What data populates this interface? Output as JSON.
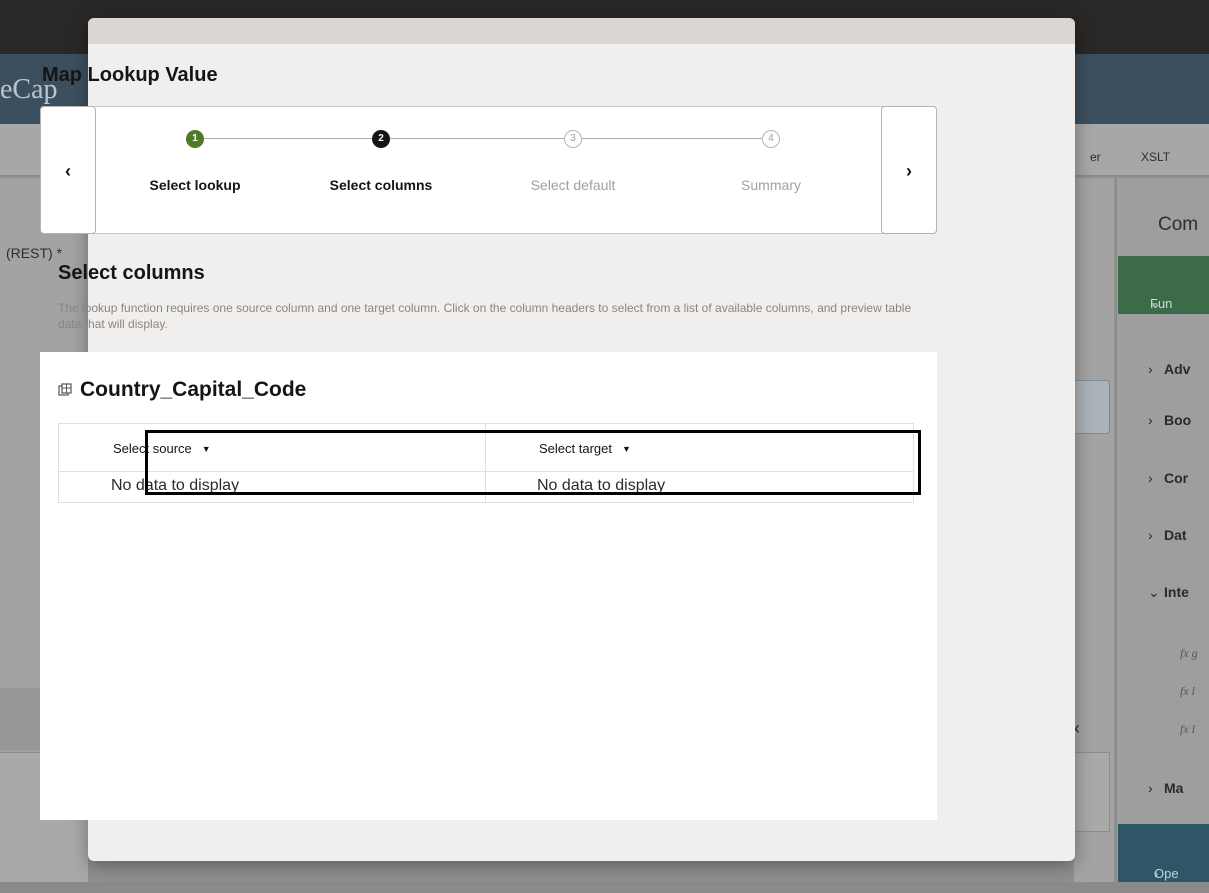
{
  "background": {
    "brand": "eCap",
    "tabs": [
      "er",
      "XSLT"
    ],
    "left_label": "(REST) *",
    "right_panel": {
      "title": "Com",
      "functions_row": "Fun",
      "items": [
        "Adv",
        "Boo",
        "Cor",
        "Dat",
        "Inte",
        "Ma"
      ],
      "fx_items": [
        "fx g",
        "fx l",
        "fx l"
      ],
      "bottom_row": "Ope"
    }
  },
  "modal": {
    "title": "Map Lookup Value",
    "train": {
      "steps": [
        {
          "number": "1",
          "label": "Select lookup",
          "state": "done"
        },
        {
          "number": "2",
          "label": "Select columns",
          "state": "current"
        },
        {
          "number": "3",
          "label": "Select default",
          "state": "future"
        },
        {
          "number": "4",
          "label": "Summary",
          "state": "future"
        }
      ],
      "prev_icon": "chevron-left-icon",
      "next_icon": "chevron-right-icon"
    },
    "section": {
      "title": "Select columns",
      "description": "The lookup function requires one source column and one target column. Click on the column headers to select from a list of available columns, and preview table data that will display."
    },
    "table": {
      "name": "Country_Capital_Code",
      "icon": "table-icon",
      "columns": [
        {
          "label": "Select source",
          "icon": "caret-down-icon"
        },
        {
          "label": "Select target",
          "icon": "caret-down-icon"
        }
      ],
      "rows": [
        [
          "No data to display",
          "No data to display"
        ]
      ]
    }
  },
  "colors": {
    "done_step": "#4f7a28",
    "current_step": "#161513",
    "functions_row": "#3b6b48",
    "highlight": "#000000"
  }
}
